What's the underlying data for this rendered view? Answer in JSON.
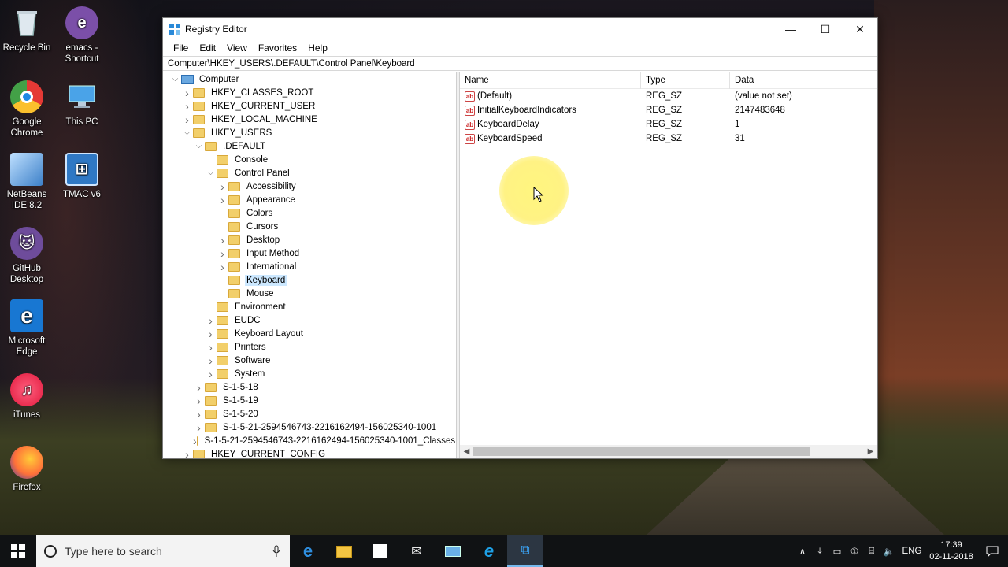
{
  "desktop": {
    "icons": [
      {
        "name": "recycle-bin",
        "label": "Recycle Bin"
      },
      {
        "name": "emacs-shortcut",
        "label": "emacs - Shortcut"
      },
      {
        "name": "google-chrome",
        "label": "Google Chrome"
      },
      {
        "name": "this-pc",
        "label": "This PC"
      },
      {
        "name": "netbeans",
        "label": "NetBeans IDE 8.2"
      },
      {
        "name": "tmac",
        "label": "TMAC v6"
      },
      {
        "name": "github-desktop",
        "label": "GitHub Desktop"
      },
      {
        "name": "microsoft-edge",
        "label": "Microsoft Edge"
      },
      {
        "name": "itunes",
        "label": "iTunes"
      },
      {
        "name": "firefox",
        "label": "Firefox"
      }
    ]
  },
  "window": {
    "title": "Registry Editor",
    "controls": {
      "minimize": "—",
      "maximize": "☐",
      "close": "✕"
    },
    "menu": [
      "File",
      "Edit",
      "View",
      "Favorites",
      "Help"
    ],
    "address": "Computer\\HKEY_USERS\\.DEFAULT\\Control Panel\\Keyboard"
  },
  "tree": {
    "nodes": [
      {
        "label": "Computer",
        "level": 0,
        "exp": "down",
        "kind": "pc"
      },
      {
        "label": "HKEY_CLASSES_ROOT",
        "level": 1,
        "exp": "right"
      },
      {
        "label": "HKEY_CURRENT_USER",
        "level": 1,
        "exp": "right"
      },
      {
        "label": "HKEY_LOCAL_MACHINE",
        "level": 1,
        "exp": "right"
      },
      {
        "label": "HKEY_USERS",
        "level": 1,
        "exp": "down"
      },
      {
        "label": ".DEFAULT",
        "level": 2,
        "exp": "down"
      },
      {
        "label": "Console",
        "level": 3,
        "exp": ""
      },
      {
        "label": "Control Panel",
        "level": 3,
        "exp": "down"
      },
      {
        "label": "Accessibility",
        "level": 4,
        "exp": "right"
      },
      {
        "label": "Appearance",
        "level": 4,
        "exp": "right"
      },
      {
        "label": "Colors",
        "level": 4,
        "exp": ""
      },
      {
        "label": "Cursors",
        "level": 4,
        "exp": ""
      },
      {
        "label": "Desktop",
        "level": 4,
        "exp": "right"
      },
      {
        "label": "Input Method",
        "level": 4,
        "exp": "right"
      },
      {
        "label": "International",
        "level": 4,
        "exp": "right"
      },
      {
        "label": "Keyboard",
        "level": 4,
        "exp": "",
        "selected": true
      },
      {
        "label": "Mouse",
        "level": 4,
        "exp": ""
      },
      {
        "label": "Environment",
        "level": 3,
        "exp": ""
      },
      {
        "label": "EUDC",
        "level": 3,
        "exp": "right"
      },
      {
        "label": "Keyboard Layout",
        "level": 3,
        "exp": "right"
      },
      {
        "label": "Printers",
        "level": 3,
        "exp": "right"
      },
      {
        "label": "Software",
        "level": 3,
        "exp": "right"
      },
      {
        "label": "System",
        "level": 3,
        "exp": "right"
      },
      {
        "label": "S-1-5-18",
        "level": 2,
        "exp": "right"
      },
      {
        "label": "S-1-5-19",
        "level": 2,
        "exp": "right"
      },
      {
        "label": "S-1-5-20",
        "level": 2,
        "exp": "right"
      },
      {
        "label": "S-1-5-21-2594546743-2216162494-156025340-1001",
        "level": 2,
        "exp": "right"
      },
      {
        "label": "S-1-5-21-2594546743-2216162494-156025340-1001_Classes",
        "level": 2,
        "exp": "right"
      },
      {
        "label": "HKEY_CURRENT_CONFIG",
        "level": 1,
        "exp": "right"
      }
    ]
  },
  "values": {
    "headers": {
      "name": "Name",
      "type": "Type",
      "data": "Data"
    },
    "rows": [
      {
        "name": "(Default)",
        "type": "REG_SZ",
        "data": "(value not set)"
      },
      {
        "name": "InitialKeyboardIndicators",
        "type": "REG_SZ",
        "data": "2147483648"
      },
      {
        "name": "KeyboardDelay",
        "type": "REG_SZ",
        "data": "1"
      },
      {
        "name": "KeyboardSpeed",
        "type": "REG_SZ",
        "data": "31"
      }
    ]
  },
  "taskbar": {
    "search_placeholder": "Type here to search",
    "apps": [
      "edge-icon",
      "file-explorer-icon",
      "store-icon",
      "mail-icon",
      "network-icon",
      "internet-explorer-icon",
      "regedit-icon"
    ],
    "tray_language": "ENG",
    "time": "17:39",
    "date": "02-11-2018"
  }
}
